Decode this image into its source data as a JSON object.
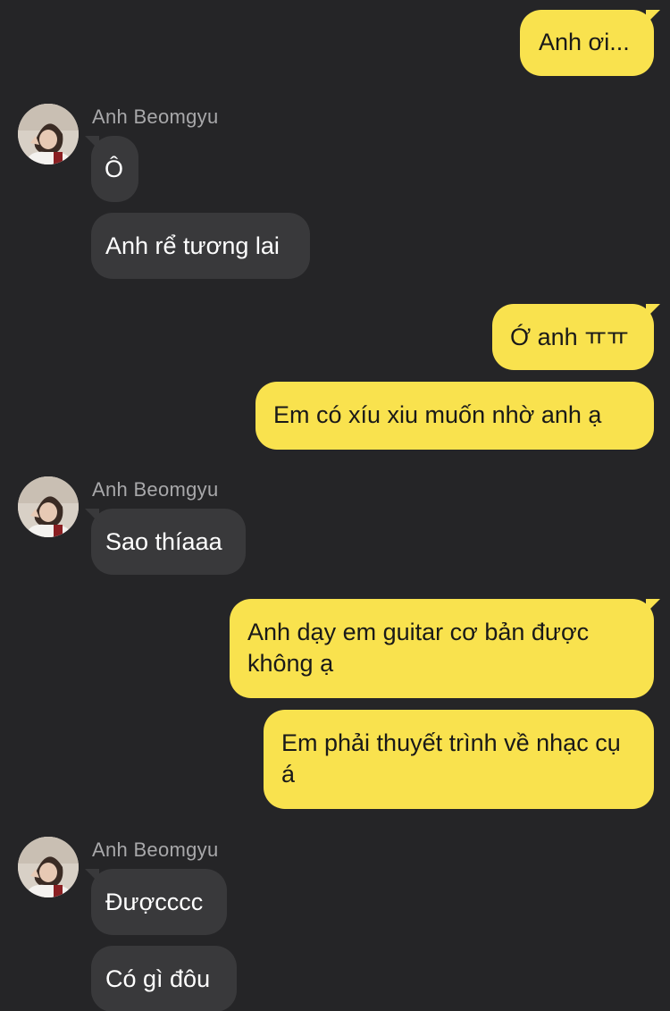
{
  "conversation": {
    "contact_name": "Anh Beomgyu",
    "messages": [
      {
        "from": "me",
        "text": "Anh ơi..."
      },
      {
        "from": "them",
        "sender": "Anh Beomgyu",
        "text": "Ô"
      },
      {
        "from": "them",
        "text": "Anh rể tương lai"
      },
      {
        "from": "me",
        "text": "Ớ anh ㅠㅠ"
      },
      {
        "from": "me",
        "text": "Em có xíu xiu muốn nhờ anh ạ"
      },
      {
        "from": "them",
        "sender": "Anh Beomgyu",
        "text": "Sao thíaaa"
      },
      {
        "from": "me",
        "text": "Anh dạy em guitar cơ bản được không ạ"
      },
      {
        "from": "me",
        "text": "Em phải thuyết trình về nhạc cụ á"
      },
      {
        "from": "them",
        "sender": "Anh Beomgyu",
        "text": "Đượcccc"
      },
      {
        "from": "them",
        "text": "Có gì đôu"
      }
    ]
  },
  "colors": {
    "background": "#252527",
    "my_bubble": "#f9e24e",
    "their_bubble": "#39393b",
    "sender_name": "#a8a8aa"
  },
  "icons": {
    "avatar": "contact-avatar-photo"
  }
}
